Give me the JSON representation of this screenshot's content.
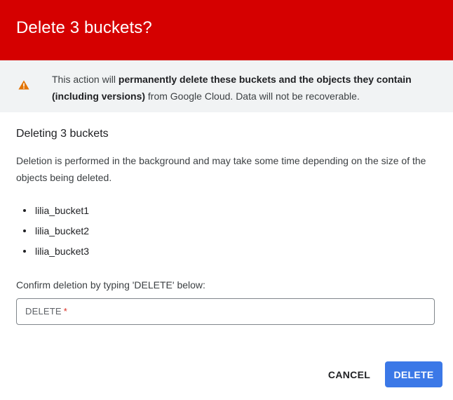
{
  "dialog": {
    "title": "Delete 3 buckets?"
  },
  "warning": {
    "icon": "warning-icon",
    "icon_color": "#e37400",
    "text_part1": "This action will ",
    "text_bold1": "permanently delete these buckets and the objects they contain (including versions)",
    "text_part2": " from Google Cloud. Data will not be recoverable."
  },
  "section": {
    "title": "Deleting 3 buckets",
    "description": "Deletion is performed in the background and may take some time depending on the size of the objects being deleted."
  },
  "buckets": [
    "lilia_bucket1",
    "lilia_bucket2",
    "lilia_bucket3"
  ],
  "confirm": {
    "label": "Confirm deletion by typing 'DELETE' below:",
    "placeholder": "DELETE",
    "required_marker": "*",
    "value": ""
  },
  "actions": {
    "cancel_label": "CANCEL",
    "delete_label": "DELETE"
  },
  "colors": {
    "header_bg": "#d50000",
    "warning_bg": "#f1f3f4",
    "primary_button": "#3b78e7",
    "required_star": "#d93025"
  }
}
